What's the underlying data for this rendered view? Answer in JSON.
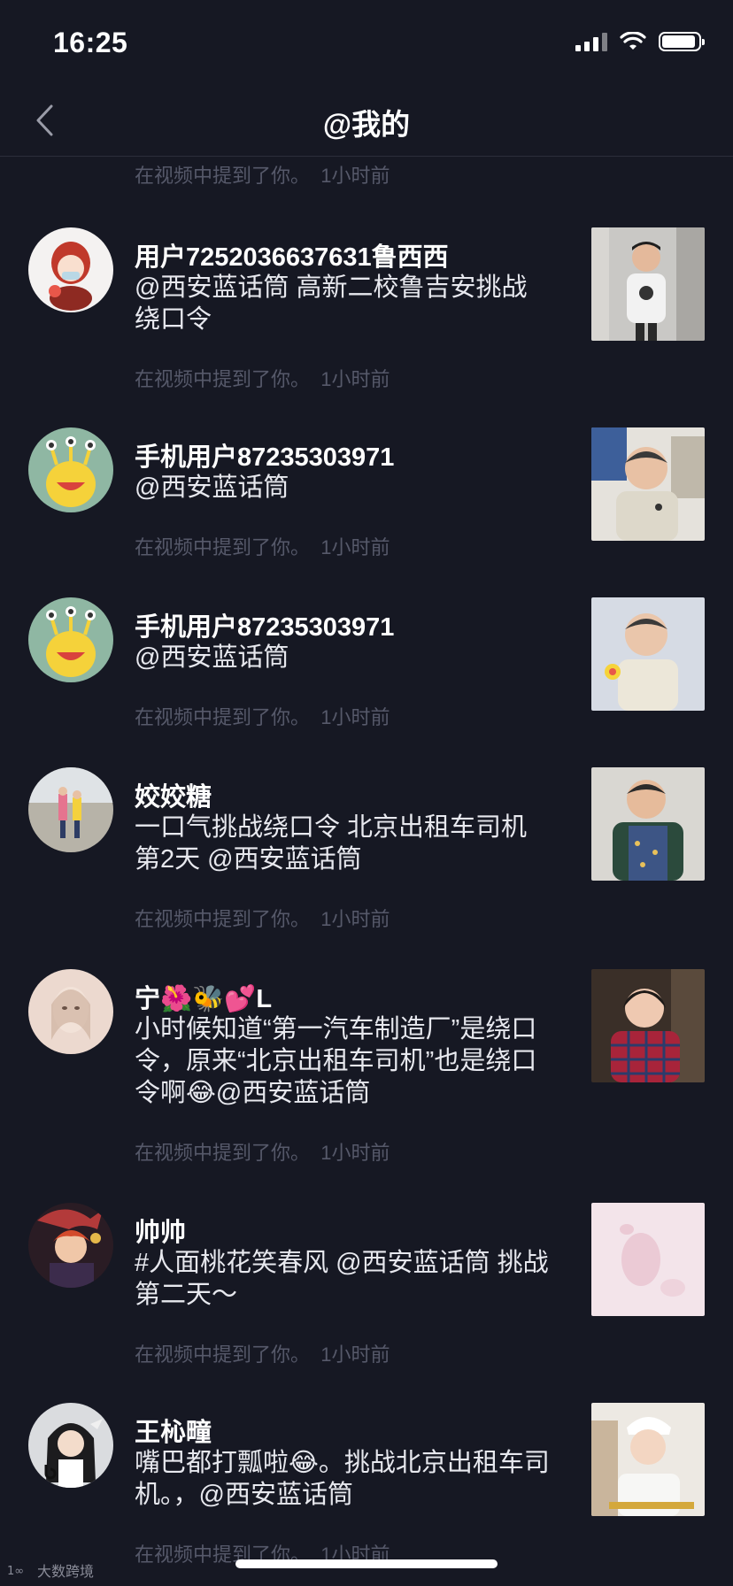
{
  "status_bar": {
    "time": "16:25"
  },
  "nav": {
    "title": "@我的"
  },
  "top_item_meta": "在视频中提到了你。  1小时前",
  "items": [
    {
      "name": "用户7252036637631鲁西西",
      "text": "@西安蓝话筒 高新二校鲁吉安挑战绕口令",
      "meta": "在视频中提到了你。  1小时前"
    },
    {
      "name": "手机用户87235303971",
      "text": "@西安蓝话筒",
      "meta": "在视频中提到了你。  1小时前"
    },
    {
      "name": "手机用户87235303971",
      "text": "@西安蓝话筒",
      "meta": "在视频中提到了你。  1小时前"
    },
    {
      "name": "姣姣糖",
      "text": "一口气挑战绕口令 北京出租车司机第2天 @西安蓝话筒",
      "meta": "在视频中提到了你。  1小时前"
    },
    {
      "name": "宁🌺🐝💕L",
      "text": "小时候知道“第一汽车制造厂”是绕口令，原来“北京出租车司机”也是绕口令啊😂@西安蓝话筒",
      "meta": "在视频中提到了你。  1小时前"
    },
    {
      "name": "帅帅",
      "text": "#人面桃花笑春风 @西安蓝话筒 挑战第二天～",
      "meta": "在视频中提到了你。  1小时前"
    },
    {
      "name": "王杺疃",
      "text": "嘴巴都打瓢啦😂。挑战北京出租车司机。，@西安蓝话筒",
      "meta": "在视频中提到了你。  1小时前"
    }
  ],
  "watermark": "大数跨境",
  "colors": {
    "background": "#161823",
    "meta_text": "#56596a",
    "primary_text": "#ffffff"
  }
}
